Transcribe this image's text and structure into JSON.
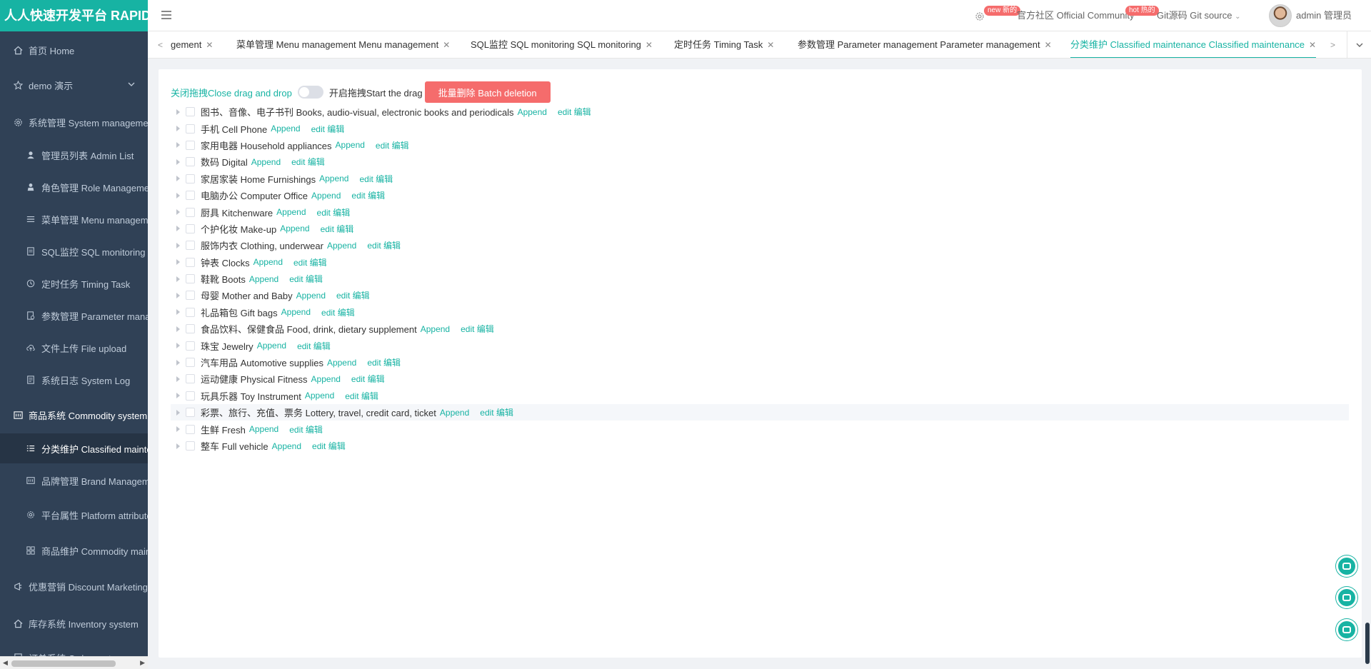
{
  "app": {
    "logo_text": "人人快速开发平台 RAPID"
  },
  "sidebar": {
    "items": [
      {
        "label": "首页 Home",
        "icon": "home-icon"
      },
      {
        "label": "demo 演示",
        "icon": "star-icon"
      },
      {
        "label": "系统管理 System management",
        "icon": "gear-icon"
      },
      {
        "label": "管理员列表 Admin List",
        "icon": "user-icon"
      },
      {
        "label": "角色管理 Role Management",
        "icon": "role-icon"
      },
      {
        "label": "菜单管理 Menu management",
        "icon": "menu-list-icon"
      },
      {
        "label": "SQL监控 SQL monitoring",
        "icon": "sql-icon"
      },
      {
        "label": "定时任务 Timing Task",
        "icon": "clock-icon"
      },
      {
        "label": "参数管理 Parameter management",
        "icon": "param-icon"
      },
      {
        "label": "文件上传 File upload",
        "icon": "upload-icon"
      },
      {
        "label": "系统日志 System Log",
        "icon": "log-icon"
      },
      {
        "label": "商品系统 Commodity system",
        "icon": "commodity-icon"
      },
      {
        "label": "分类维护 Classified maintenance",
        "icon": "list-icon"
      },
      {
        "label": "品牌管理 Brand Management",
        "icon": "brand-icon"
      },
      {
        "label": "平台属性 Platform attributes",
        "icon": "attribute-gear-icon"
      },
      {
        "label": "商品维护 Commodity maintenance",
        "icon": "grid-icon"
      },
      {
        "label": "优惠营销 Discount Marketing",
        "icon": "marketing-icon"
      },
      {
        "label": "库存系统 Inventory system",
        "icon": "warehouse-icon"
      },
      {
        "label": "订单系统 Order system",
        "icon": "order-icon"
      }
    ]
  },
  "header": {
    "community_badge": "new 新的",
    "community_label": "官方社区 Official Community",
    "git_badge": "hot 热的",
    "git_label": "Git源码 Git source",
    "user_name": "admin 管理员"
  },
  "tabs": [
    {
      "label": "gement"
    },
    {
      "label": "菜单管理 Menu management Menu management"
    },
    {
      "label": "SQL监控 SQL monitoring SQL monitoring"
    },
    {
      "label": "定时任务 Timing Task"
    },
    {
      "label": "参数管理 Parameter management Parameter management"
    },
    {
      "label": "分类维护 Classified maintenance Classified maintenance",
      "active": true
    }
  ],
  "toolbar": {
    "close_drag": "关闭拖拽Close drag and drop",
    "open_drag": "开启拖拽Start the drag",
    "drag_enabled": false,
    "batch_delete": "批量删除 Batch deletion"
  },
  "tree": {
    "append_label": "Append",
    "edit_label": "edit 编辑",
    "rows": [
      "图书、音像、电子书刊 Books, audio-visual, electronic books and periodicals",
      "手机 Cell Phone",
      "家用电器 Household appliances",
      "数码 Digital",
      "家居家装 Home Furnishings",
      "电脑办公 Computer Office",
      "厨具 Kitchenware",
      "个护化妆 Make-up",
      "服饰内衣 Clothing, underwear",
      "钟表 Clocks",
      "鞋靴 Boots",
      "母婴 Mother and Baby",
      "礼品箱包 Gift bags",
      "食品饮料、保健食品 Food, drink, dietary supplement",
      "珠宝 Jewelry",
      "汽车用品 Automotive supplies",
      "运动健康 Physical Fitness",
      "玩具乐器 Toy Instrument",
      "彩票、旅行、充值、票务 Lottery, travel, credit card, ticket",
      "生鲜 Fresh",
      "整车 Full vehicle"
    ]
  },
  "colors": {
    "accent": "#17b3a3",
    "danger": "#f56c6c",
    "sidebar_bg": "#304156"
  }
}
